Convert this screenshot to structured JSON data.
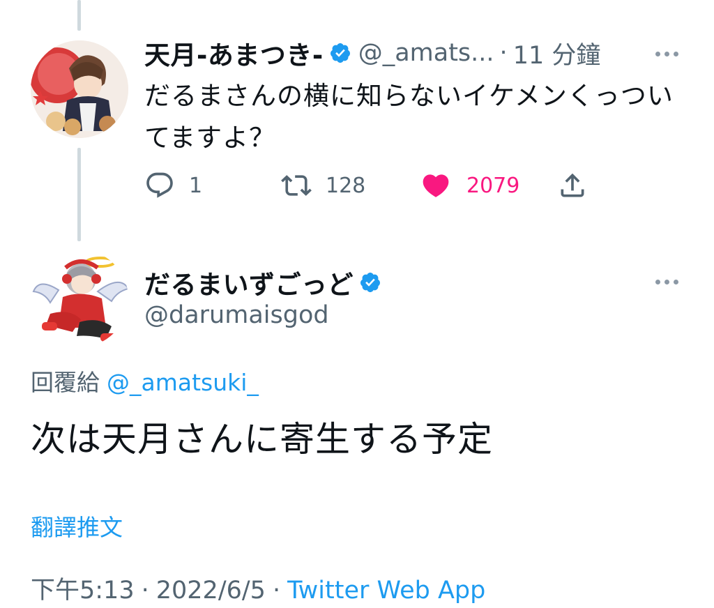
{
  "tweet1": {
    "author_name": "天月-あまつき-",
    "handle": "@_amats...",
    "time": "11 分鐘",
    "separator": "·",
    "text": "だるまさんの横に知らないイケメンくっついてますよ？",
    "reply_count": "1",
    "retweet_count": "128",
    "like_count": "2079",
    "liked": true
  },
  "tweet2": {
    "author_name": "だるまいずごっど",
    "handle": "@darumaisgod",
    "reply_label": "回覆給",
    "reply_mention": "@_amatsuki_",
    "text": "次は天月さんに寄生する予定",
    "translate_label": "翻譯推文",
    "time": "下午5:13",
    "date": "2022/6/5",
    "source": "Twitter Web App",
    "separator": "·"
  },
  "colors": {
    "accent": "#1d9bf0",
    "like": "#f91880",
    "secondary_text": "#536471",
    "thread_line": "#cfd9de"
  },
  "icons": [
    "verified-badge-icon",
    "more-options-icon",
    "reply-icon",
    "retweet-icon",
    "heart-icon",
    "share-icon"
  ]
}
